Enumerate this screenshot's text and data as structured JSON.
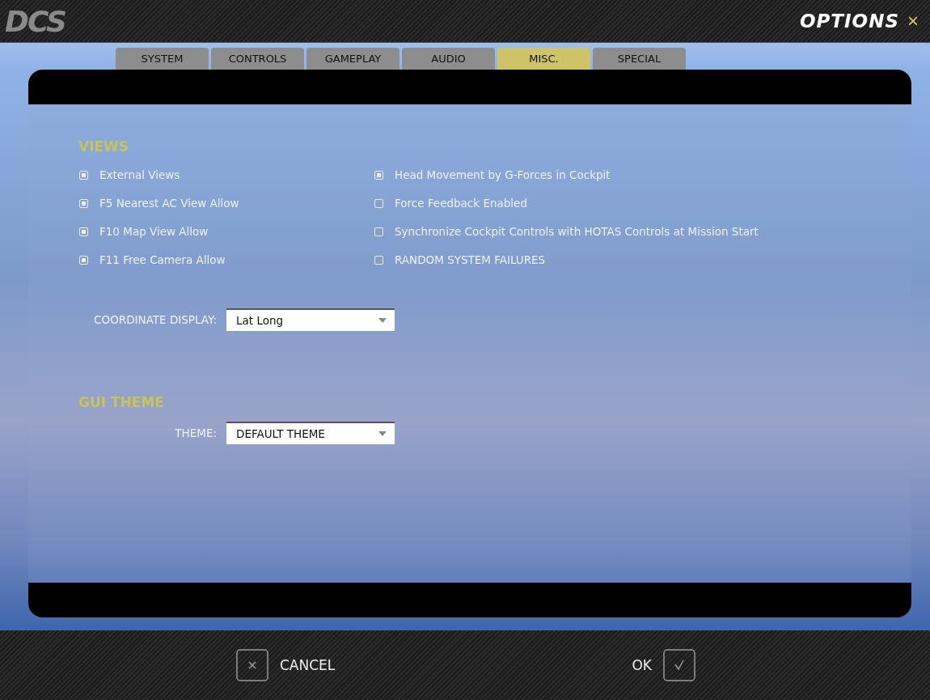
{
  "header": {
    "logo": "DCS",
    "title": "OPTIONS",
    "close": "×"
  },
  "tabs": [
    {
      "label": "SYSTEM",
      "selected": false
    },
    {
      "label": "CONTROLS",
      "selected": false
    },
    {
      "label": "GAMEPLAY",
      "selected": false
    },
    {
      "label": "AUDIO",
      "selected": false
    },
    {
      "label": "MISC.",
      "selected": true
    },
    {
      "label": "SPECIAL",
      "selected": false
    }
  ],
  "views": {
    "heading": "VIEWS",
    "left": [
      {
        "label": "External Views",
        "checked": true
      },
      {
        "label": "F5 Nearest AC View Allow",
        "checked": true
      },
      {
        "label": "F10 Map View Allow",
        "checked": true
      },
      {
        "label": "F11 Free Camera Allow",
        "checked": true
      }
    ],
    "right": [
      {
        "label": "Head Movement by G-Forces in Cockpit",
        "checked": true
      },
      {
        "label": "Force Feedback Enabled",
        "checked": false
      },
      {
        "label": "Synchronize Cockpit Controls with HOTAS Controls at Mission Start",
        "checked": false
      },
      {
        "label": "RANDOM SYSTEM FAILURES",
        "checked": false
      }
    ],
    "coordinate": {
      "label": "COORDINATE DISPLAY:",
      "value": "Lat Long"
    }
  },
  "gui_theme": {
    "heading": "GUI THEME",
    "theme": {
      "label": "THEME:",
      "value": "DEFAULT THEME"
    }
  },
  "footer": {
    "cancel": "CANCEL",
    "ok": "OK"
  }
}
